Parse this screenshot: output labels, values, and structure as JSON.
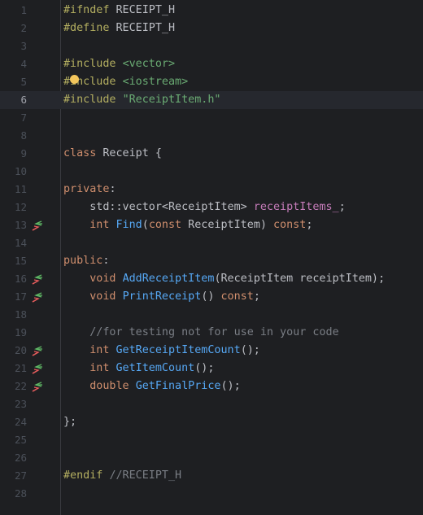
{
  "editor": {
    "current_line": 6,
    "lines": [
      {
        "num": "1",
        "marker": "",
        "tokens": [
          {
            "c": "pp",
            "t": "#ifndef"
          },
          {
            "c": "punc",
            "t": " RECEIPT_H"
          }
        ]
      },
      {
        "num": "2",
        "marker": "",
        "tokens": [
          {
            "c": "pp",
            "t": "#define"
          },
          {
            "c": "punc",
            "t": " RECEIPT_H"
          }
        ]
      },
      {
        "num": "3",
        "marker": "",
        "tokens": []
      },
      {
        "num": "4",
        "marker": "",
        "tokens": [
          {
            "c": "pp",
            "t": "#include"
          },
          {
            "c": "punc",
            "t": " "
          },
          {
            "c": "str",
            "t": "<vector>"
          }
        ]
      },
      {
        "num": "5",
        "marker": "",
        "tokens": [
          {
            "c": "pp",
            "t": "#include"
          },
          {
            "c": "punc",
            "t": " "
          },
          {
            "c": "str",
            "t": "<iostream>"
          }
        ]
      },
      {
        "num": "6",
        "marker": "",
        "tokens": [
          {
            "c": "pp",
            "t": "#include"
          },
          {
            "c": "punc",
            "t": " "
          },
          {
            "c": "str",
            "t": "\"ReceiptItem.h\""
          }
        ]
      },
      {
        "num": "7",
        "marker": "",
        "tokens": []
      },
      {
        "num": "8",
        "marker": "",
        "tokens": []
      },
      {
        "num": "9",
        "marker": "",
        "tokens": [
          {
            "c": "kw",
            "t": "class"
          },
          {
            "c": "punc",
            "t": " Receipt {"
          }
        ]
      },
      {
        "num": "10",
        "marker": "",
        "tokens": []
      },
      {
        "num": "11",
        "marker": "",
        "tokens": [
          {
            "c": "kw",
            "t": "private"
          },
          {
            "c": "punc",
            "t": ":"
          }
        ]
      },
      {
        "num": "12",
        "marker": "",
        "tokens": [
          {
            "c": "punc",
            "t": "    std::vector<ReceiptItem> "
          },
          {
            "c": "field",
            "t": "receiptItems_"
          },
          {
            "c": "punc",
            "t": ";"
          }
        ]
      },
      {
        "num": "13",
        "marker": "impl",
        "tokens": [
          {
            "c": "punc",
            "t": "    "
          },
          {
            "c": "kw",
            "t": "int"
          },
          {
            "c": "punc",
            "t": " "
          },
          {
            "c": "fn",
            "t": "Find"
          },
          {
            "c": "punc",
            "t": "("
          },
          {
            "c": "kw",
            "t": "const"
          },
          {
            "c": "punc",
            "t": " ReceiptItem) "
          },
          {
            "c": "kw",
            "t": "const"
          },
          {
            "c": "punc",
            "t": ";"
          }
        ]
      },
      {
        "num": "14",
        "marker": "",
        "tokens": []
      },
      {
        "num": "15",
        "marker": "",
        "tokens": [
          {
            "c": "kw",
            "t": "public"
          },
          {
            "c": "punc",
            "t": ":"
          }
        ]
      },
      {
        "num": "16",
        "marker": "impl",
        "tokens": [
          {
            "c": "punc",
            "t": "    "
          },
          {
            "c": "kw",
            "t": "void"
          },
          {
            "c": "punc",
            "t": " "
          },
          {
            "c": "fn",
            "t": "AddReceiptItem"
          },
          {
            "c": "punc",
            "t": "(ReceiptItem receiptItem);"
          }
        ]
      },
      {
        "num": "17",
        "marker": "impl",
        "tokens": [
          {
            "c": "punc",
            "t": "    "
          },
          {
            "c": "kw",
            "t": "void"
          },
          {
            "c": "punc",
            "t": " "
          },
          {
            "c": "fn",
            "t": "PrintReceipt"
          },
          {
            "c": "punc",
            "t": "() "
          },
          {
            "c": "kw",
            "t": "const"
          },
          {
            "c": "punc",
            "t": ";"
          }
        ]
      },
      {
        "num": "18",
        "marker": "",
        "tokens": []
      },
      {
        "num": "19",
        "marker": "",
        "tokens": [
          {
            "c": "punc",
            "t": "    "
          },
          {
            "c": "cmt",
            "t": "//for testing not for use in your code"
          }
        ]
      },
      {
        "num": "20",
        "marker": "impl",
        "tokens": [
          {
            "c": "punc",
            "t": "    "
          },
          {
            "c": "kw",
            "t": "int"
          },
          {
            "c": "punc",
            "t": " "
          },
          {
            "c": "fn",
            "t": "GetReceiptItemCount"
          },
          {
            "c": "punc",
            "t": "();"
          }
        ]
      },
      {
        "num": "21",
        "marker": "impl",
        "tokens": [
          {
            "c": "punc",
            "t": "    "
          },
          {
            "c": "kw",
            "t": "int"
          },
          {
            "c": "punc",
            "t": " "
          },
          {
            "c": "fn",
            "t": "GetItemCount"
          },
          {
            "c": "punc",
            "t": "();"
          }
        ]
      },
      {
        "num": "22",
        "marker": "impl",
        "tokens": [
          {
            "c": "punc",
            "t": "    "
          },
          {
            "c": "kw",
            "t": "double"
          },
          {
            "c": "punc",
            "t": " "
          },
          {
            "c": "fn",
            "t": "GetFinalPrice"
          },
          {
            "c": "punc",
            "t": "();"
          }
        ]
      },
      {
        "num": "23",
        "marker": "",
        "tokens": []
      },
      {
        "num": "24",
        "marker": "",
        "tokens": [
          {
            "c": "punc",
            "t": "};"
          }
        ]
      },
      {
        "num": "25",
        "marker": "",
        "tokens": []
      },
      {
        "num": "26",
        "marker": "",
        "tokens": []
      },
      {
        "num": "27",
        "marker": "",
        "tokens": [
          {
            "c": "pp",
            "t": "#endif"
          },
          {
            "c": "punc",
            "t": " "
          },
          {
            "c": "cmt",
            "t": "//RECEIPT_H"
          }
        ]
      },
      {
        "num": "28",
        "marker": "",
        "tokens": []
      }
    ]
  },
  "colors": {
    "background": "#1e1f22",
    "keyword": "#cf8e6d",
    "preprocessor": "#b3ae60",
    "string": "#6aab73",
    "function": "#56a8f5",
    "field": "#c77dbb",
    "comment": "#7a7e85",
    "marker_green": "#5fb865",
    "marker_red": "#e55c5c",
    "intention_bulb": "#f2c55c"
  },
  "icons": {
    "gutter_marker": "implementation-navigation-arrows-icon",
    "intention": "lightbulb-icon"
  }
}
